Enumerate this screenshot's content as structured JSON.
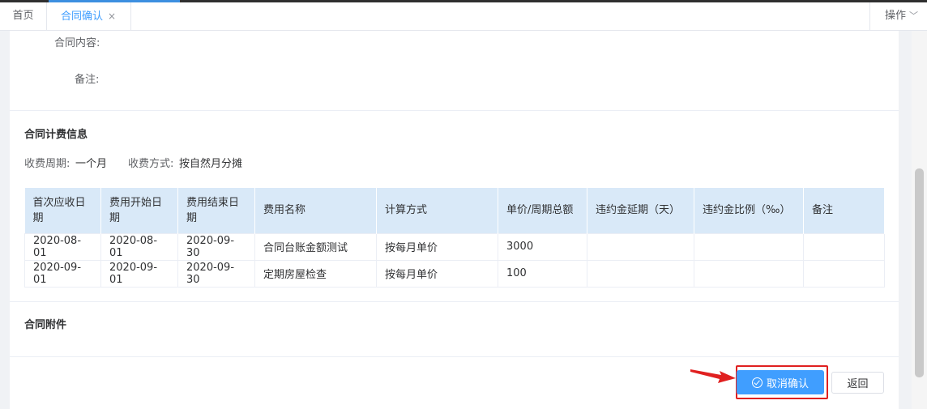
{
  "tabs": {
    "home": "首页",
    "active": "合同确认",
    "active_close": "×",
    "operations": "操作"
  },
  "contract": {
    "content_label": "合同内容:",
    "remark_label": "备注:"
  },
  "billing": {
    "title": "合同计费信息",
    "period_label": "收费周期:",
    "period_value": "一个月",
    "method_label": "收费方式:",
    "method_value": "按自然月分摊",
    "table": {
      "headers": [
        "首次应收日期",
        "费用开始日期",
        "费用结束日期",
        "费用名称",
        "计算方式",
        "单价/周期总额",
        "违约金延期（天）",
        "违约金比例（‰）",
        "备注"
      ],
      "rows": [
        [
          "2020-08-01",
          "2020-08-01",
          "2020-09-30",
          "合同台账金额测试",
          "按每月单价",
          "3000",
          "",
          "",
          ""
        ],
        [
          "2020-09-01",
          "2020-09-01",
          "2020-09-30",
          "定期房屋检查",
          "按每月单价",
          "100",
          "",
          "",
          ""
        ]
      ]
    }
  },
  "attachments": {
    "title": "合同附件"
  },
  "actions": {
    "cancel_confirm": "取消确认",
    "back": "返回"
  },
  "colors": {
    "primary": "#409eff",
    "highlight": "#e02020",
    "header_bg": "#d9e9f8"
  }
}
